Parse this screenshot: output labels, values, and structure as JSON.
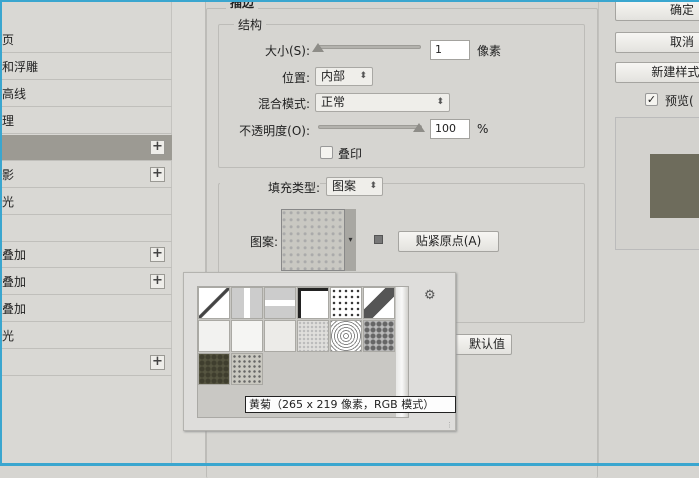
{
  "sidebar": {
    "items": [
      {
        "label": "页",
        "plus": false,
        "selected": false
      },
      {
        "label": "和浮雕",
        "plus": false,
        "selected": false
      },
      {
        "label": "高线",
        "plus": false,
        "selected": false
      },
      {
        "label": "理",
        "plus": false,
        "selected": false
      },
      {
        "label": "",
        "plus": true,
        "selected": true
      },
      {
        "label": "影",
        "plus": true,
        "selected": false
      },
      {
        "label": "光",
        "plus": false,
        "selected": false
      },
      {
        "label": "",
        "plus": false,
        "selected": false
      },
      {
        "label": "叠加",
        "plus": true,
        "selected": false
      },
      {
        "label": "叠加",
        "plus": true,
        "selected": false
      },
      {
        "label": "叠加",
        "plus": false,
        "selected": false
      },
      {
        "label": "光",
        "plus": false,
        "selected": false
      },
      {
        "label": "",
        "plus": true,
        "selected": false
      }
    ],
    "plus_glyph": "+"
  },
  "stroke": {
    "title": "描边",
    "structure": {
      "title": "结构",
      "size_label": "大小(S):",
      "size_value": "1",
      "size_unit": "像素",
      "position_label": "位置:",
      "position_value": "内部",
      "blend_label": "混合模式:",
      "blend_value": "正常",
      "opacity_label": "不透明度(O):",
      "opacity_value": "100",
      "opacity_unit": "%",
      "opacity_percent": 100,
      "overprint_label": "叠印",
      "overprint_checked": false
    },
    "fill": {
      "type_label": "填充类型:",
      "type_value": "图案",
      "pattern_label": "图案:",
      "snap_button": "贴紧原点(A)",
      "reset_button": "默认值"
    }
  },
  "picker": {
    "tooltip": "黄菊（265 x 219 像素，RGB 模式）",
    "gear": "⚙"
  },
  "buttons": {
    "ok": "确定",
    "cancel": "取消",
    "new_style": "新建样式(",
    "preview_label": "预览(",
    "preview_checked": true
  },
  "colors": {
    "preview_swatch": "#6e6c5c",
    "selected_row": "#9c9a93",
    "frame": "#3aa6cf"
  }
}
